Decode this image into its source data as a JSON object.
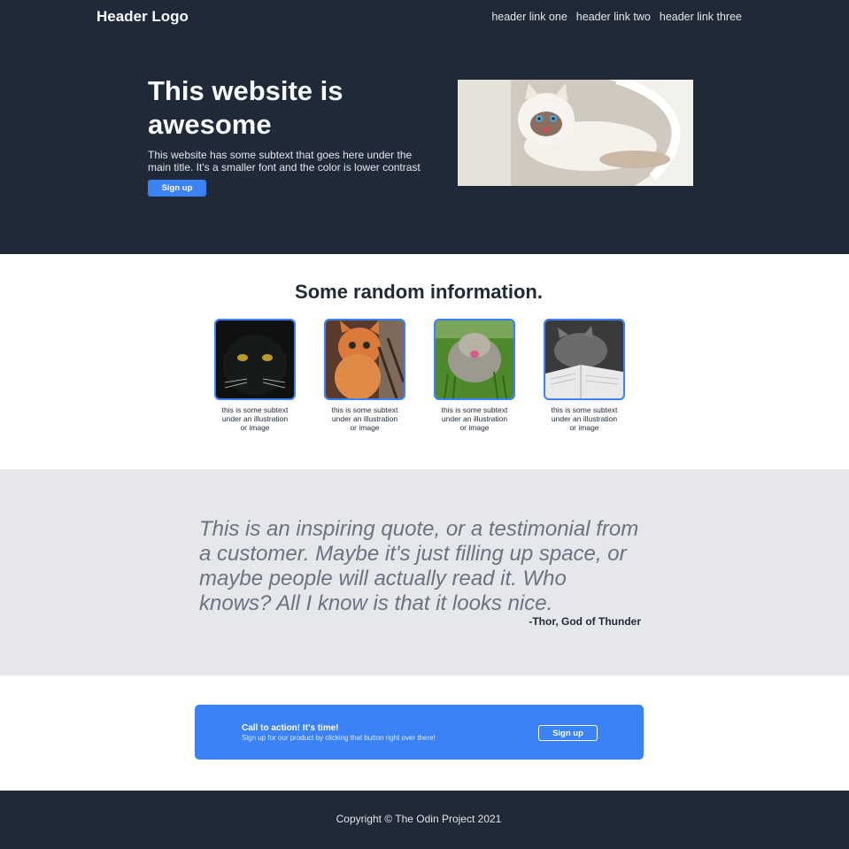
{
  "colors": {
    "dark": "#1f2937",
    "accent": "#3b82f6",
    "light_gray": "#e5e7eb",
    "quote_text": "#6b7280"
  },
  "header": {
    "logo": "Header Logo",
    "links": [
      "header link one",
      "header link two",
      "header link three"
    ]
  },
  "hero": {
    "title": "This website is awesome",
    "subtext": "This website has some subtext that goes here under the main title. It's a smaller font and the color is lower contrast",
    "button": "Sign up",
    "image": "cat-photo"
  },
  "info": {
    "title": "Some random information.",
    "cards": [
      {
        "image": "black-cat-photo",
        "text": "this is some subtext under an illustration or image"
      },
      {
        "image": "orange-kitten-photo",
        "text": "this is some subtext under an illustration or image"
      },
      {
        "image": "cat-in-grass-photo",
        "text": "this is some subtext under an illustration or image"
      },
      {
        "image": "cat-with-book-photo",
        "text": "this is some subtext under an illustration or image"
      }
    ]
  },
  "quote": {
    "text": "This is an inspiring quote, or a testimonial from a customer. Maybe it's just filling up space, or maybe people will actually read it. Who knows? All I know is that it looks nice.",
    "author": "-Thor, God of Thunder"
  },
  "cta": {
    "title": "Call to action! It's time!",
    "subtext": "Sign up for our product by clicking that button right over there!",
    "button": "Sign up"
  },
  "footer": {
    "copyright": "Copyright © The Odin Project 2021"
  }
}
